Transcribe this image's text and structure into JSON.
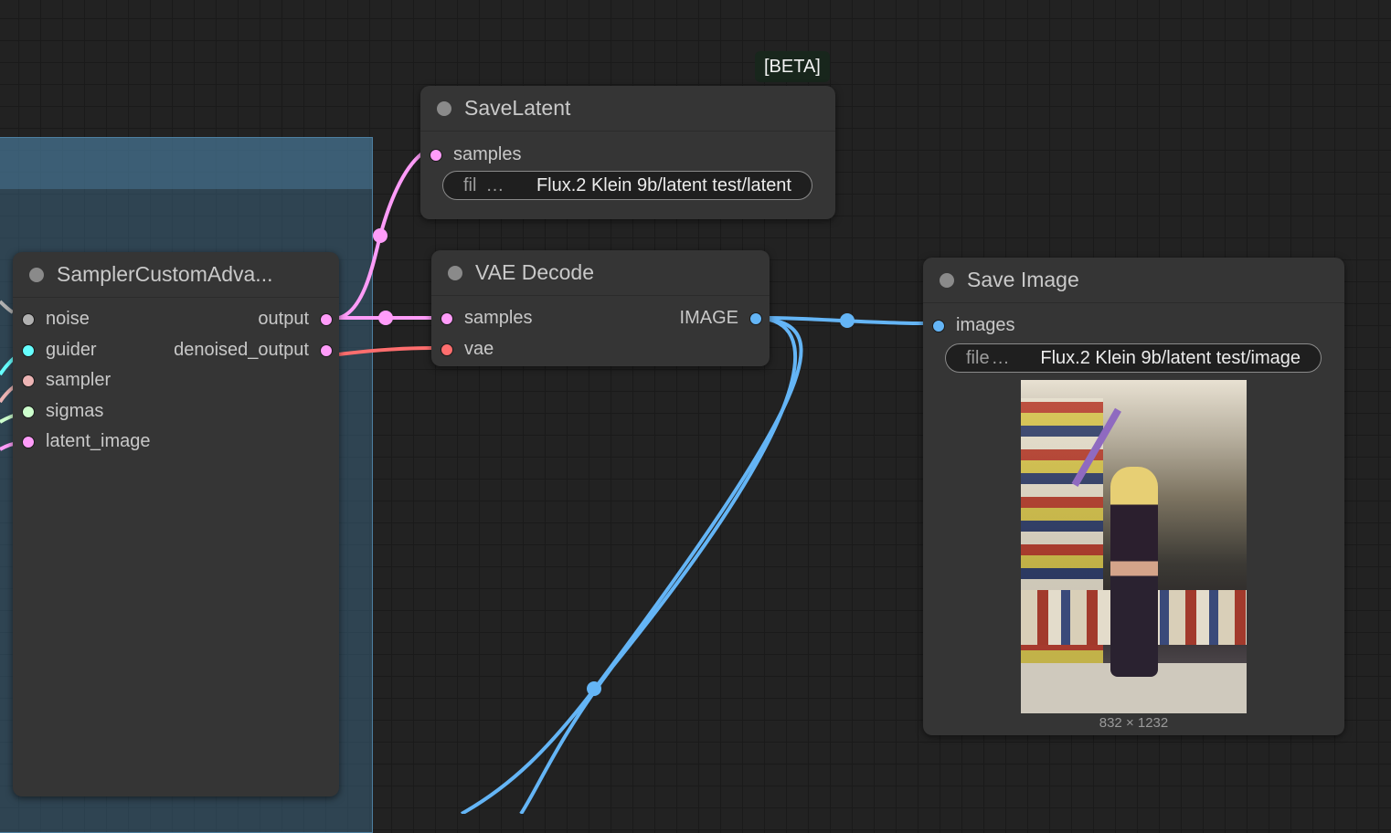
{
  "canvas": {
    "beta_badge": "[BETA]"
  },
  "nodes": {
    "sampler": {
      "title": "SamplerCustomAdva...",
      "inputs": [
        "noise",
        "guider",
        "sampler",
        "sigmas",
        "latent_image"
      ],
      "outputs": [
        "output",
        "denoised_output"
      ]
    },
    "save_latent": {
      "title": "SaveLatent",
      "inputs": [
        "samples"
      ],
      "widget": {
        "label": "fil",
        "ellipsis": "…",
        "value": "Flux.2 Klein 9b/latent test/latent"
      }
    },
    "vae_decode": {
      "title": "VAE Decode",
      "inputs": [
        "samples",
        "vae"
      ],
      "outputs": [
        "IMAGE"
      ]
    },
    "save_image": {
      "title": "Save Image",
      "inputs": [
        "images"
      ],
      "widget": {
        "label": "file",
        "ellipsis": "…",
        "value": "Flux.2 Klein 9b/latent test/image"
      },
      "preview_size": "832 × 1232"
    }
  },
  "colors": {
    "canvas_bg": "#222222",
    "node_bg": "#353535",
    "latent": "#ff9cf9",
    "image": "#64b5f6",
    "vae": "#ff6e6e",
    "noise": "#b0b0b0",
    "guider": "#66ffff",
    "sampler": "#ecb4b4",
    "sigmas": "#cdffcd",
    "group": "#3a607a"
  },
  "icons": [
    "collapse-dot-icon",
    "slot-dot-icon"
  ]
}
